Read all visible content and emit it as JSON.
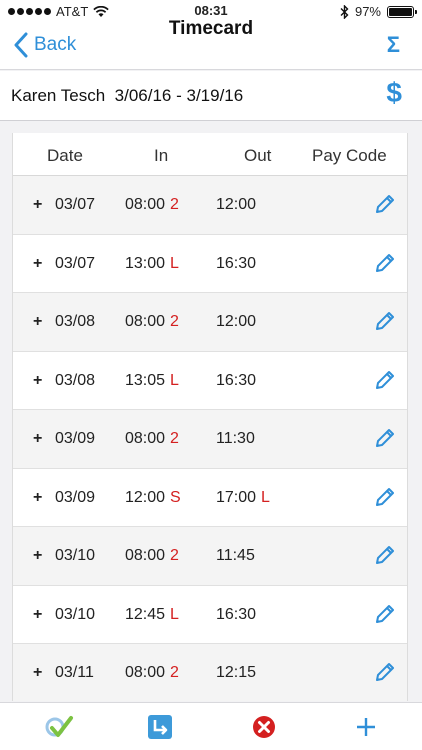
{
  "status_bar": {
    "carrier": "AT&T",
    "time": "08:31",
    "battery": "97%"
  },
  "nav": {
    "back_label": "Back",
    "title": "Timecard",
    "summary_icon": "Σ"
  },
  "header": {
    "employee": "Karen Tesch",
    "period": "3/06/16 - 3/19/16",
    "dollar_icon": "$"
  },
  "table": {
    "columns": [
      "Date",
      "In",
      "Out",
      "Pay Code"
    ],
    "rows": [
      {
        "date": "03/07",
        "in": "08:00",
        "in_code": "2",
        "out": "12:00",
        "out_code": ""
      },
      {
        "date": "03/07",
        "in": "13:00",
        "in_code": "L",
        "out": "16:30",
        "out_code": ""
      },
      {
        "date": "03/08",
        "in": "08:00",
        "in_code": "2",
        "out": "12:00",
        "out_code": ""
      },
      {
        "date": "03/08",
        "in": "13:05",
        "in_code": "L",
        "out": "16:30",
        "out_code": ""
      },
      {
        "date": "03/09",
        "in": "08:00",
        "in_code": "2",
        "out": "11:30",
        "out_code": ""
      },
      {
        "date": "03/09",
        "in": "12:00",
        "in_code": "S",
        "out": "17:00",
        "out_code": "L"
      },
      {
        "date": "03/10",
        "in": "08:00",
        "in_code": "2",
        "out": "11:45",
        "out_code": ""
      },
      {
        "date": "03/10",
        "in": "12:45",
        "in_code": "L",
        "out": "16:30",
        "out_code": ""
      },
      {
        "date": "03/11",
        "in": "08:00",
        "in_code": "2",
        "out": "12:15",
        "out_code": ""
      }
    ]
  },
  "toolbar": {
    "items": [
      "approve-check-icon",
      "transfer-arrow-icon",
      "delete-x-icon",
      "add-plus-icon"
    ]
  },
  "colors": {
    "accent": "#2f8fd8",
    "code_red": "#d42020",
    "delete_red": "#d42020",
    "check_green": "#7cc242"
  }
}
